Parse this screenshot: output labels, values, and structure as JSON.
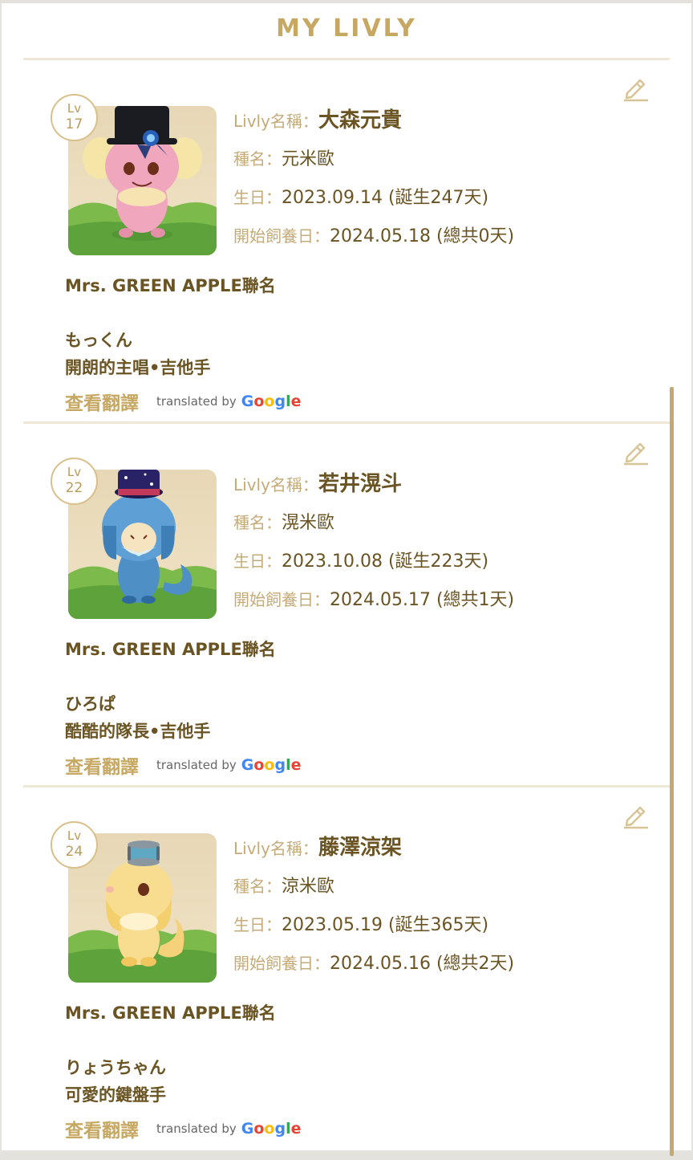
{
  "page": {
    "title": "MY LIVLY"
  },
  "labels": {
    "name": "Livly名稱：",
    "species": "種名：",
    "birthday": "生日：",
    "start": "開始飼養日："
  },
  "translate": {
    "button": "查看翻譯",
    "by": "translated by",
    "google": "Google"
  },
  "livlies": [
    {
      "lv_label": "Lv",
      "level": "17",
      "name": "大森元貴",
      "species": "元米歐",
      "birthday": "2023.09.14 (誕生247天)",
      "start": "2024.05.18 (總共0天)",
      "desc1": "Mrs. GREEN APPLE聯名",
      "desc2": "もっくん",
      "desc3": "開朗的主唱•吉他手",
      "body_color": "#f0a6bd",
      "hat": "tophat-blue-ribbon"
    },
    {
      "lv_label": "Lv",
      "level": "22",
      "name": "若井滉斗",
      "species": "滉米歐",
      "birthday": "2023.10.08 (誕生223天)",
      "start": "2024.05.17 (總共1天)",
      "desc1": "Mrs. GREEN APPLE聯名",
      "desc2": "ひろぱ",
      "desc3": "酷酷的隊長•吉他手",
      "body_color": "#4e8fc6",
      "hat": "starry-tophat"
    },
    {
      "lv_label": "Lv",
      "level": "24",
      "name": "藤澤涼架",
      "species": "涼米歐",
      "birthday": "2023.05.19 (誕生365天)",
      "start": "2024.05.16 (總共2天)",
      "desc1": "Mrs. GREEN APPLE聯名",
      "desc2": "りょうちゃん",
      "desc3": "可愛的鍵盤手",
      "body_color": "#f8dc90",
      "hat": "spool-hat"
    }
  ]
}
